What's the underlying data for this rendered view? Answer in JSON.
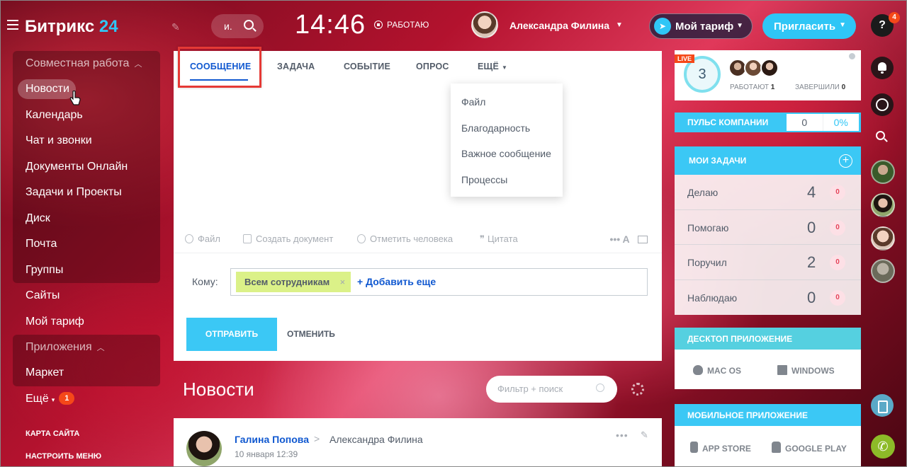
{
  "header": {
    "logo_main": "Битрикс",
    "logo_num": "24",
    "search_short": "и.",
    "clock": "14:46",
    "work_status": "РАБОТАЮ",
    "user_name": "Александра Филина",
    "tariff_btn": "Мой тариф",
    "invite_btn": "Пригласить",
    "help_label": "?",
    "help_badge": "4"
  },
  "leftmenu": {
    "group1_title": "Совместная работа",
    "items": [
      "Новости",
      "Календарь",
      "Чат и звонки",
      "Документы Онлайн",
      "Задачи и Проекты",
      "Диск",
      "Почта",
      "Группы"
    ],
    "items2": [
      "Сайты",
      "Мой тариф"
    ],
    "group2_title": "Приложения",
    "items3": [
      "Маркет"
    ],
    "more_label": "Ещё",
    "more_badge": "1",
    "sitemap_link": "КАРТА САЙТА",
    "settings_link": "НАСТРОИТЬ МЕНЮ"
  },
  "composer": {
    "tabs": [
      "СООБЩЕНИЕ",
      "ЗАДАЧА",
      "СОБЫТИЕ",
      "ОПРОС",
      "ЕЩЁ"
    ],
    "dropdown": [
      "Файл",
      "Благодарность",
      "Важное сообщение",
      "Процессы"
    ],
    "tools": [
      "Файл",
      "Создать документ",
      "Отметить человека",
      "Цитата"
    ],
    "tools_right": "••• A",
    "to_label": "Кому:",
    "to_chip": "Всем сотрудникам",
    "to_add": "+ Добавить еще",
    "send_btn": "ОТПРАВИТЬ",
    "cancel_btn": "ОТМЕНИТЬ"
  },
  "news": {
    "title": "Новости",
    "filter_placeholder": "Фильтр + поиск"
  },
  "post": {
    "author": "Галина Попова",
    "arrow": ">",
    "target": "Александра Филина",
    "date": "10 января 12:39"
  },
  "right": {
    "live_badge": "LIVE",
    "live_count": "3",
    "working_label": "РАБОТАЮТ",
    "working_count": "1",
    "done_label": "ЗАВЕРШИЛИ",
    "done_count": "0",
    "pulse_label": "ПУЛЬС КОМПАНИИ",
    "pulse_value": "0",
    "pulse_percent": "0%",
    "tasks_title": "МОИ ЗАДАЧИ",
    "tasks": [
      {
        "name": "Делаю",
        "count": "4",
        "badge": "0"
      },
      {
        "name": "Помогаю",
        "count": "0",
        "badge": "0"
      },
      {
        "name": "Поручил",
        "count": "2",
        "badge": "0"
      },
      {
        "name": "Наблюдаю",
        "count": "0",
        "badge": "0"
      }
    ],
    "desktop_title": "ДЕСКТОП ПРИЛОЖЕНИЕ",
    "desktop_mac": "MAC OS",
    "desktop_win": "WINDOWS",
    "mobile_title": "МОБИЛЬНОЕ ПРИЛОЖЕНИЕ",
    "mobile_appstore": "APP STORE",
    "mobile_gplay": "GOOGLE PLAY"
  },
  "colors": {
    "accent": "#2fc6f6",
    "link": "#1058d0",
    "badge": "#f54819",
    "highlight": "#e53935"
  }
}
